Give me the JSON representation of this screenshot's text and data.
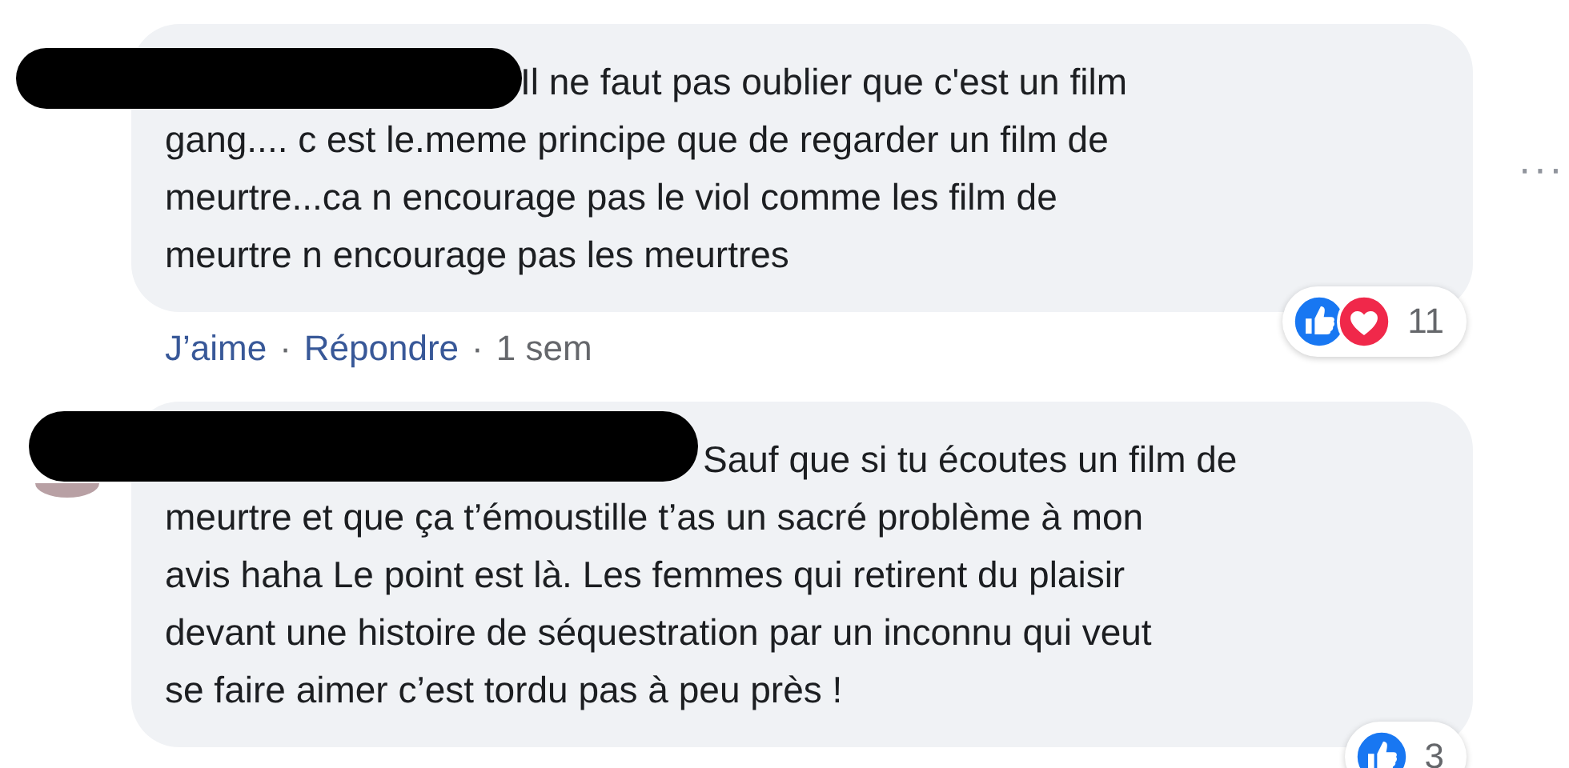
{
  "comments": [
    {
      "lines": [
        "Il ne faut pas oublier que c'est un film",
        "gang.... c est le.meme principe que de regarder un film de",
        "meurtre...ca n encourage pas le viol comme les film de",
        "meurtre n encourage pas les meurtres"
      ],
      "reactions": [
        {
          "kind": "like"
        },
        {
          "kind": "love"
        }
      ],
      "reaction_count": "11",
      "actions": [
        "J’aime",
        "Répondre"
      ],
      "separator": "·",
      "time": "1 sem",
      "menu": "···"
    },
    {
      "lines": [
        "Sauf que si tu écoutes un film de",
        "meurtre et que ça t’émoustille t’as un sacré problème à mon",
        "avis haha Le point est là. Les femmes qui retirent du plaisir",
        "devant une histoire de séquestration par un inconnu qui veut",
        "se faire aimer c’est tordu pas à peu près !"
      ],
      "reactions": [
        {
          "kind": "like"
        }
      ],
      "reaction_count": "3"
    }
  ]
}
